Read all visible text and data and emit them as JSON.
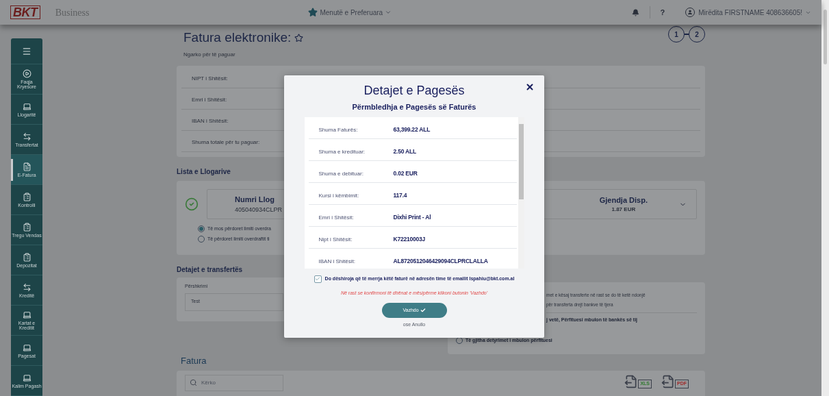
{
  "topbar": {
    "logo_text": "BKT",
    "product": "Business",
    "favorites": "Menutë e Preferuara",
    "help": "?",
    "user": "Mirëdita FIRSTNAME 408636605!"
  },
  "sidebar": [
    {
      "kind": "play",
      "label": "Faqja Kryesore",
      "selected": false
    },
    {
      "kind": "laptop",
      "label": "Llogaritë",
      "selected": false
    },
    {
      "kind": "transfer",
      "label": "Transfertat",
      "selected": false
    },
    {
      "kind": "invoice",
      "label": "E-Fatura",
      "selected": true
    },
    {
      "kind": "clipboard",
      "label": "Kontrolli",
      "selected": false
    },
    {
      "kind": "clipboard",
      "label": "Tregu Vendas",
      "selected": false
    },
    {
      "kind": "clipboard",
      "label": "Depozitat",
      "selected": false
    },
    {
      "kind": "transfer",
      "label": "Kreditë",
      "selected": false
    },
    {
      "kind": "laptop",
      "label": "Kartat e Kreditit",
      "selected": false
    },
    {
      "kind": "laptop",
      "label": "Pagesat",
      "selected": false
    },
    {
      "kind": "laptop",
      "label": "Kalim Pagash",
      "selected": false
    }
  ],
  "page": {
    "title": "Fatura elektronike:",
    "subtitle": "Ngarko për të paguar",
    "steps": [
      "1",
      "2"
    ]
  },
  "seller_fields": [
    "NIPT i Shitësit:",
    "Emri i Shitësit:",
    "IBAN i Shitësit:",
    "Shuma totale për tu paguar:"
  ],
  "accounts": {
    "heading": "Lista e Llogarive",
    "account": {
      "name": "Numri Llog",
      "number": "405040934CLPR",
      "balance_label": "Gjendja Disp.",
      "balance": "1.87 EUR",
      "selected": true
    },
    "overdraft_options": [
      {
        "label": "Të mos përdoret limiti overdra",
        "selected": true
      },
      {
        "label": "Të përdoret limiti overdraftit ti",
        "selected": false
      }
    ]
  },
  "transfer": {
    "heading": "Detajet e transfertës",
    "description_label": "Përshkrimi",
    "description_value": "Test",
    "fee_lines": [
      "met e kësaj transferte në rast se do të ketë ndonjë",
      "për transferta drejt bankve të tjera"
    ],
    "fee_note": "j vetë, Përfituesi mbulon të bankës së tij",
    "fee_options": [
      {
        "label": "Të gjitha detyrimet i mbulon përfituesi",
        "selected": false
      }
    ]
  },
  "invoices": {
    "heading": "Fatura",
    "search_placeholder": "Kërko",
    "exports": [
      "XLS",
      "PDF"
    ]
  },
  "modal": {
    "title": "Detajet e Pagesës",
    "subtitle": "Përmbledhja e Pagesës së Faturës",
    "rows": [
      {
        "label": "Shuma Faturës:",
        "value": "63,399.22 ALL"
      },
      {
        "label": "Shuma e kredituar:",
        "value": "2.50 ALL"
      },
      {
        "label": "Shuma e debituar:",
        "value": "0.02 EUR"
      },
      {
        "label": "Kursi i këmbimit:",
        "value": "117.4"
      },
      {
        "label": "Emri i Shitësit:",
        "value": "Dixhi Print - Al"
      },
      {
        "label": "Nipt i Shitësit:",
        "value": "K72210003J"
      },
      {
        "label": "IBAN i Shitësit:",
        "value": "AL8720512046429094CLPRCLALLA"
      }
    ],
    "email_opt_in": {
      "label": "Do dëshiroja që të merrja këtë faturë në adresën time të emailit lspahiu@bkt.com.al",
      "checked": true
    },
    "warning": "Në rast se konfirmoni të dhënat e mësipërme klikoni butonin 'Vazhdo'",
    "confirm": "Vazhdo",
    "cancel": "ose Anullo"
  }
}
